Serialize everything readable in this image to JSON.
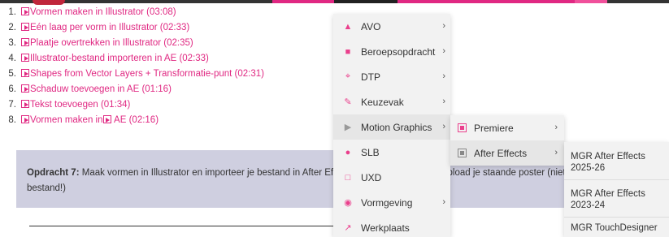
{
  "colors": {
    "accent": "#e02882",
    "assignment_bg": "#cfcfe0",
    "menu_bg": "#f2f2f2",
    "text": "#333333"
  },
  "lessons": [
    {
      "num": "1.",
      "title": "Vormen maken in Illustrator (03:08)"
    },
    {
      "num": "2.",
      "title": "Eén laag per vorm in Illustrator (02:33)"
    },
    {
      "num": "3.",
      "title": "Plaatje overtrekken in Illustrator (02:35)"
    },
    {
      "num": "4.",
      "title": "Illustrator-bestand importeren in AE (02:33)"
    },
    {
      "num": "5.",
      "title": "Shapes from Vector Layers + Transformatie-punt (02:31)"
    },
    {
      "num": "6.",
      "title": "Schaduw toevoegen in AE (01:16)"
    },
    {
      "num": "7.",
      "title": "Tekst toevoegen (01:34)"
    },
    {
      "num": "8.",
      "title_a": "Vormen maken in",
      "title_b": " AE (02:16)"
    }
  ],
  "assignment": {
    "label": "Opdracht 7:",
    "text": " Maak vormen in Illustrator en importeer je bestand in After Effects. Exporteer (MP4) en upload je staande poster (niet je After Effects-bestand!)"
  },
  "menu": {
    "items": [
      {
        "label": "AVO",
        "icon": "megaphone-icon",
        "has_sub": true
      },
      {
        "label": "Beroepsopdracht",
        "icon": "briefcase-icon",
        "has_sub": true
      },
      {
        "label": "DTP",
        "icon": "crop-icon",
        "has_sub": true
      },
      {
        "label": "Keuzevak",
        "icon": "brush-icon",
        "has_sub": true
      },
      {
        "label": "Motion Graphics",
        "icon": "play-icon",
        "has_sub": true
      },
      {
        "label": "SLB",
        "icon": "chat-icon",
        "has_sub": false
      },
      {
        "label": "UXD",
        "icon": "layout-icon",
        "has_sub": false
      },
      {
        "label": "Vormgeving",
        "icon": "eye-icon",
        "has_sub": true
      },
      {
        "label": "Werkplaats",
        "icon": "wrench-icon",
        "has_sub": false
      }
    ],
    "chevron": "›"
  },
  "submenu": {
    "items": [
      {
        "label": "Premiere",
        "icon": "film-icon"
      },
      {
        "label": "After Effects",
        "icon": "film-icon"
      }
    ]
  },
  "subsubmenu": {
    "items": [
      {
        "label": "MGR After Effects 2025-26"
      },
      {
        "label": "MGR After Effects 2023-24"
      },
      {
        "label": "MGR TouchDesigner"
      }
    ]
  }
}
